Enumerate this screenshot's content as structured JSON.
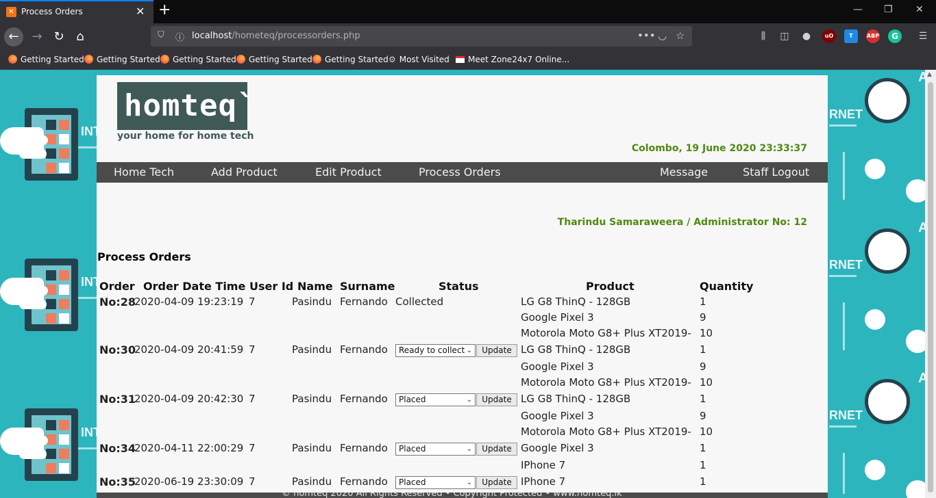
{
  "browser": {
    "tab_title": "Process Orders",
    "url_host": "localhost",
    "url_path": "/hometeq/processorders.php",
    "bookmarks": [
      "Getting Started",
      "Getting Started",
      "Getting Started",
      "Getting Started",
      "Getting Started",
      "Most Visited",
      "Meet Zone24x7 Online..."
    ]
  },
  "site": {
    "logo": "homteq`",
    "tagline": "your home for home tech",
    "dateline": "Colombo, 19 June 2020 23:33:37",
    "menu_left": [
      "Home Tech",
      "Add Product",
      "Edit Product",
      "Process Orders"
    ],
    "menu_right": [
      "Message",
      "Staff Logout"
    ],
    "user_line": "Tharindu Samaraweera / Administrator No: 12",
    "section_title": "Process Orders",
    "footer_text": "© homteq 2020 All Rights Reserved • Copyright Protected • www.homteq.lk",
    "update_label": "Update"
  },
  "table": {
    "headers": [
      "Order",
      "Order Date Time",
      "User Id",
      "Name",
      "Surname",
      "Status",
      "Product",
      "Quantity"
    ],
    "orders": [
      {
        "no": "No:28",
        "datetime": "2020-04-09 19:23:19",
        "user_id": "7",
        "name": "Pasindu",
        "surname": "Fernando",
        "status": "Collected",
        "editable": false,
        "items": [
          {
            "product": "LG G8 ThinQ - 128GB",
            "qty": "1"
          },
          {
            "product": "Google Pixel 3",
            "qty": "9"
          },
          {
            "product": "Motorola Moto G8+ Plus XT2019-",
            "qty": "10"
          }
        ]
      },
      {
        "no": "No:30",
        "datetime": "2020-04-09 20:41:59",
        "user_id": "7",
        "name": "Pasindu",
        "surname": "Fernando",
        "status": "Ready to collect",
        "editable": true,
        "items": [
          {
            "product": "LG G8 ThinQ - 128GB",
            "qty": "1"
          },
          {
            "product": "Google Pixel 3",
            "qty": "9"
          },
          {
            "product": "Motorola Moto G8+ Plus XT2019-",
            "qty": "10"
          }
        ]
      },
      {
        "no": "No:31",
        "datetime": "2020-04-09 20:42:30",
        "user_id": "7",
        "name": "Pasindu",
        "surname": "Fernando",
        "status": "Placed",
        "editable": true,
        "items": [
          {
            "product": "LG G8 ThinQ - 128GB",
            "qty": "1"
          },
          {
            "product": "Google Pixel 3",
            "qty": "9"
          },
          {
            "product": "Motorola Moto G8+ Plus XT2019-",
            "qty": "10"
          }
        ]
      },
      {
        "no": "No:34",
        "datetime": "2020-04-11 22:00:29",
        "user_id": "7",
        "name": "Pasindu",
        "surname": "Fernando",
        "status": "Placed",
        "editable": true,
        "items": [
          {
            "product": "Google Pixel 3",
            "qty": "1"
          },
          {
            "product": "IPhone 7",
            "qty": "1"
          }
        ]
      },
      {
        "no": "No:35",
        "datetime": "2020-06-19 23:30:09",
        "user_id": "7",
        "name": "Pasindu",
        "surname": "Fernando",
        "status": "Placed",
        "editable": true,
        "items": [
          {
            "product": "IPhone 7",
            "qty": "1"
          }
        ]
      }
    ]
  }
}
